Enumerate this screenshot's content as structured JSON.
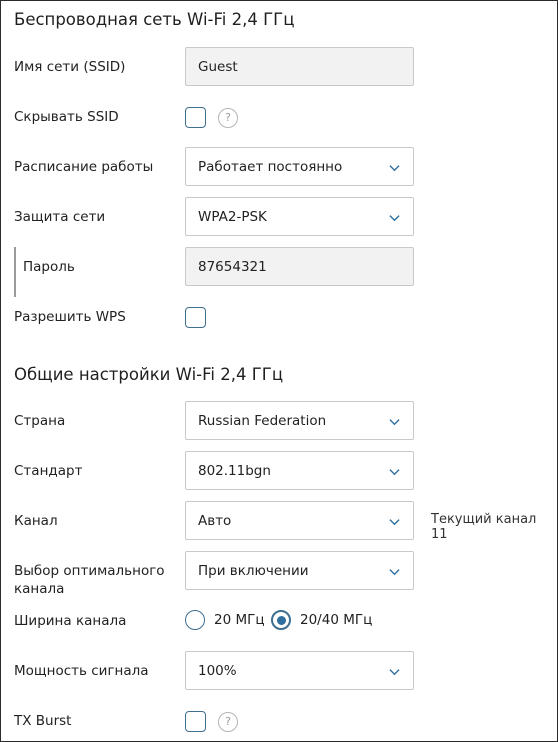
{
  "wireless": {
    "title": "Беспроводная сеть Wi-Fi 2,4 ГГц",
    "ssid_label": "Имя сети (SSID)",
    "ssid_value": "Guest",
    "hide_ssid_label": "Скрывать SSID",
    "hide_ssid_checked": false,
    "schedule_label": "Расписание работы",
    "schedule_value": "Работает постоянно",
    "security_label": "Защита сети",
    "security_value": "WPA2-PSK",
    "password_label": "Пароль",
    "password_value": "87654321",
    "wps_label": "Разрешить WPS",
    "wps_checked": false,
    "help_glyph": "?"
  },
  "general": {
    "title": "Общие настройки Wi-Fi 2,4 ГГц",
    "country_label": "Страна",
    "country_value": "Russian Federation",
    "standard_label": "Стандарт",
    "standard_value": "802.11bgn",
    "channel_label": "Канал",
    "channel_value": "Авто",
    "current_channel": "Текущий канал 11",
    "optimal_label_line1": "Выбор оптимального",
    "optimal_label_line2": "канала",
    "optimal_value": "При включении",
    "width_label": "Ширина канала",
    "width_options": [
      "20 МГц",
      "20/40 МГц"
    ],
    "width_selected": "20/40 МГц",
    "power_label": "Мощность сигнала",
    "power_value": "100%",
    "txburst_label": "TX Burst",
    "txburst_checked": false
  },
  "colors": {
    "accent": "#2f6f9f",
    "border": "#c9c9c9",
    "readonly_bg": "#f2f2f2"
  },
  "icons": {
    "dropdown": "chevron-down-icon",
    "help": "help-icon"
  }
}
